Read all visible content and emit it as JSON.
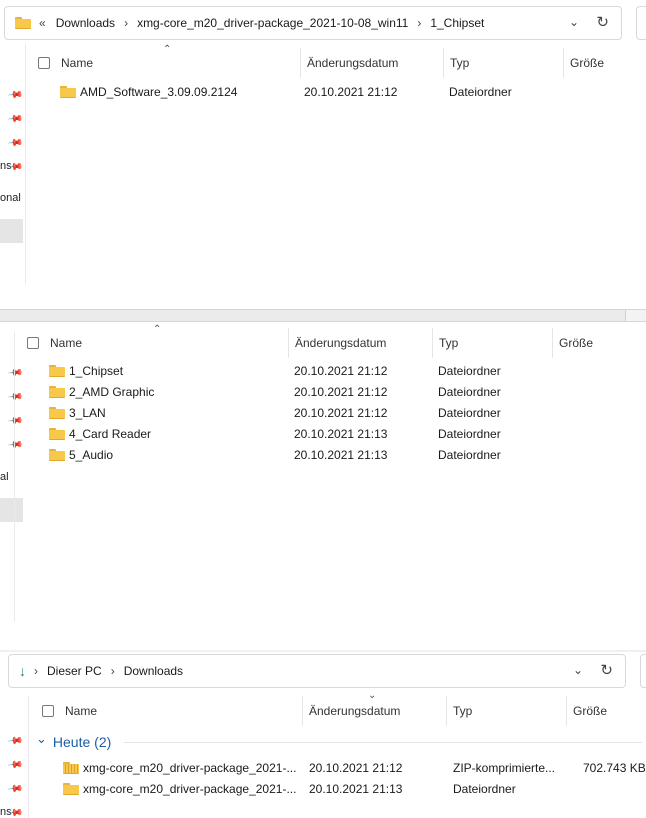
{
  "top": {
    "breadcrumb": [
      "Downloads",
      "xmg-core_m20_driver-package_2021-10-08_win11",
      "1_Chipset"
    ],
    "columns": [
      "Name",
      "Änderungsdatum",
      "Typ",
      "Größe"
    ],
    "rows": [
      {
        "name": "AMD_Software_3.09.09.2124",
        "date": "20.10.2021 21:12",
        "type": "Dateiordner",
        "size": ""
      }
    ],
    "left_labels": [
      "ns",
      "onal"
    ]
  },
  "middle": {
    "columns": [
      "Name",
      "Änderungsdatum",
      "Typ",
      "Größe"
    ],
    "rows": [
      {
        "name": "1_Chipset",
        "date": "20.10.2021 21:12",
        "type": "Dateiordner"
      },
      {
        "name": "2_AMD Graphic",
        "date": "20.10.2021 21:12",
        "type": "Dateiordner"
      },
      {
        "name": "3_LAN",
        "date": "20.10.2021 21:12",
        "type": "Dateiordner"
      },
      {
        "name": "4_Card Reader",
        "date": "20.10.2021 21:13",
        "type": "Dateiordner"
      },
      {
        "name": "5_Audio",
        "date": "20.10.2021 21:13",
        "type": "Dateiordner"
      }
    ],
    "left_labels": [
      "al"
    ]
  },
  "bottom": {
    "breadcrumb": [
      "Dieser PC",
      "Downloads"
    ],
    "columns": [
      "Name",
      "Änderungsdatum",
      "Typ",
      "Größe"
    ],
    "group": "Heute (2)",
    "rows": [
      {
        "name": "xmg-core_m20_driver-package_2021-...",
        "date": "20.10.2021 21:12",
        "type": "ZIP-komprimierte...",
        "size": "702.743 KB"
      },
      {
        "name": "xmg-core_m20_driver-package_2021-...",
        "date": "20.10.2021 21:13",
        "type": "Dateiordner",
        "size": ""
      }
    ],
    "left_labels": [
      "ns"
    ]
  },
  "glyphs": {
    "back": "«",
    "crumb_sep": "›",
    "chevron": "⌄",
    "refresh": "↻",
    "caret_up": "⌃",
    "caret_down": "⌄",
    "group_chevron": "⌄",
    "pin": "📌"
  }
}
